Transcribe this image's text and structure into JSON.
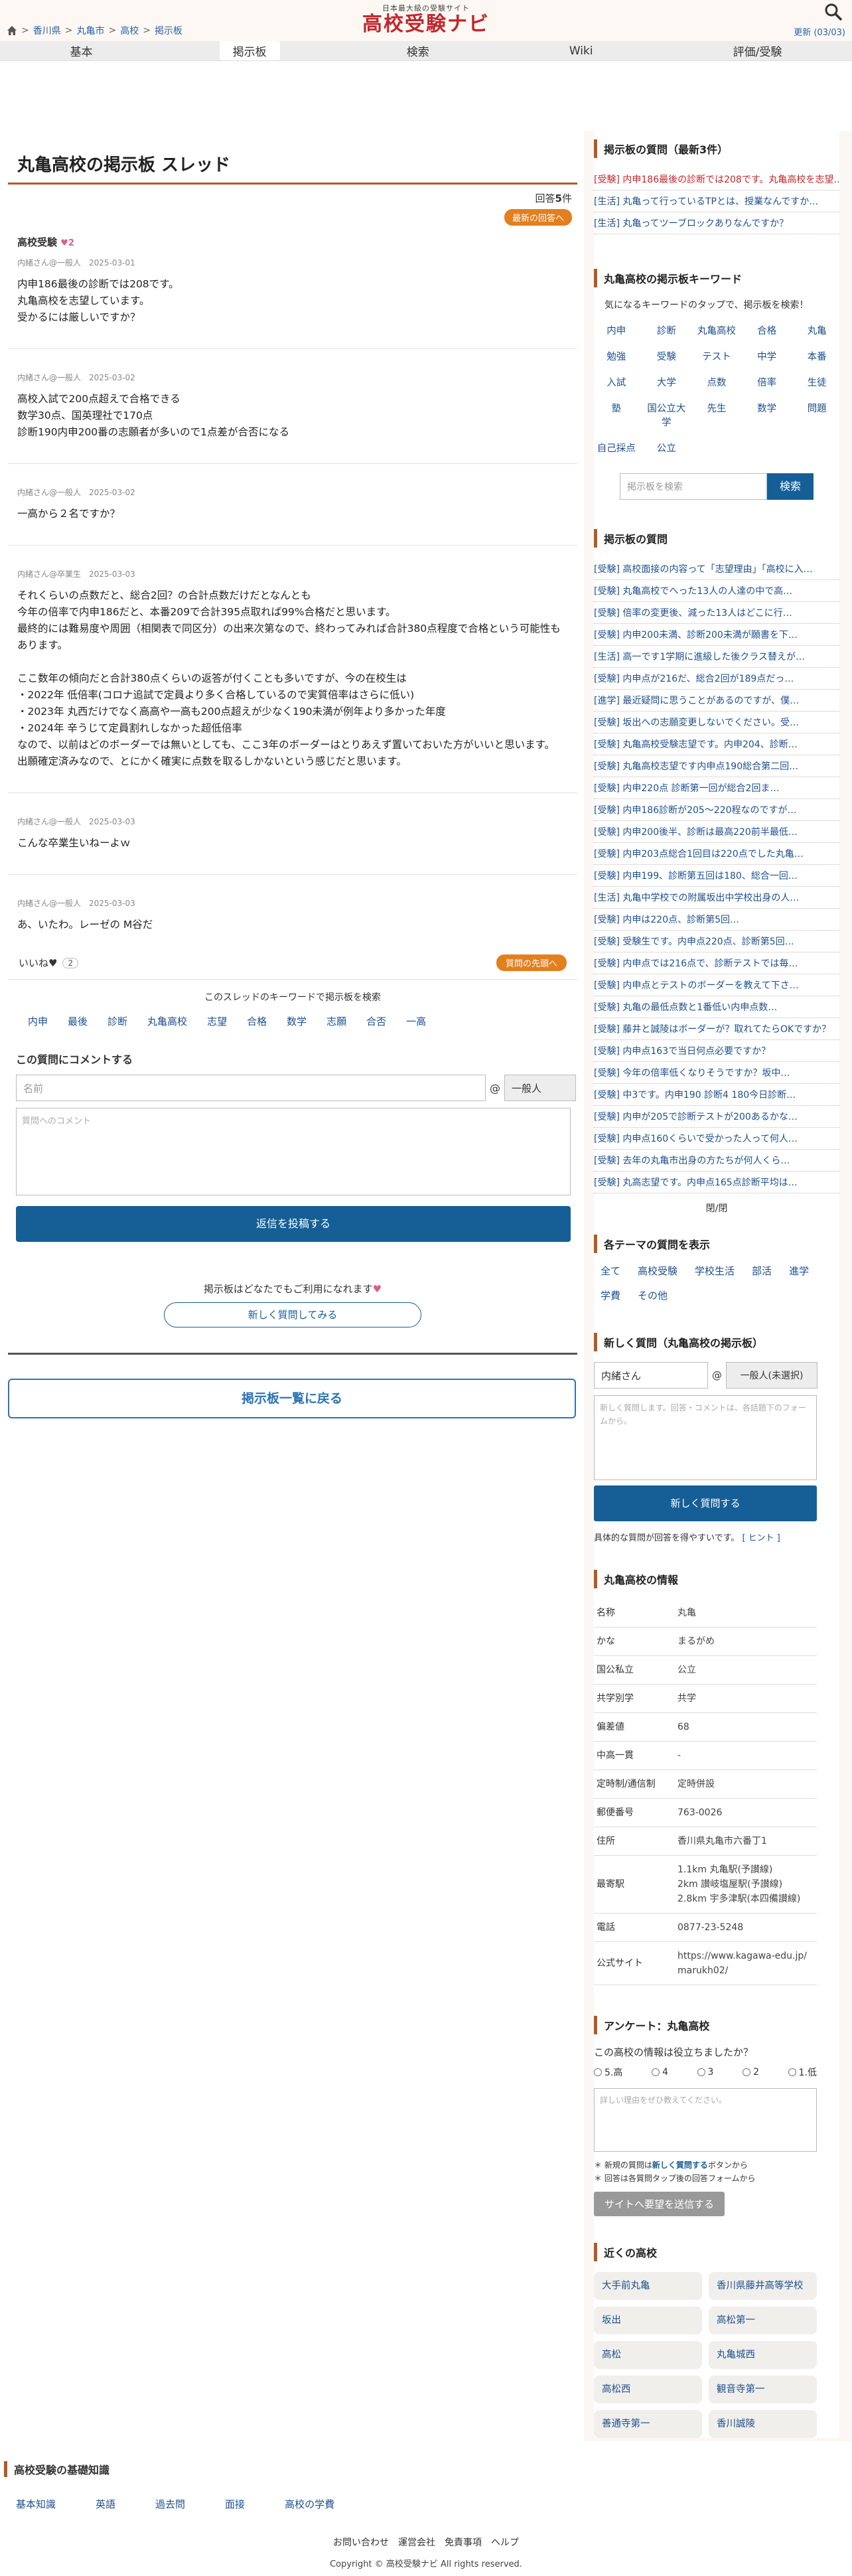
{
  "header": {
    "breadcrumb": [
      "香川県",
      "丸亀市",
      "高校",
      "掲示板"
    ],
    "logo_tag": "日本最大級の受験サイト",
    "logo_name": "高校受験ナビ",
    "updated": "更新 (03/03)"
  },
  "nav": [
    "基本",
    "掲示板",
    "検索",
    "Wiki",
    "評価/受験"
  ],
  "thread": {
    "title": "丸亀高校の掲示板 スレッド",
    "answers_label": "回答",
    "answers_count": "5",
    "answers_suffix": "件",
    "latest_btn": "最新の回答へ",
    "first_heading": "高校受験",
    "first_hearts": "♥2",
    "posts": [
      {
        "author": "内緒さん@一般人",
        "date": "2025-03-01",
        "body": "内申186最後の診断では208です。\n丸亀高校を志望しています。\n受かるには厳しいですか？"
      },
      {
        "author": "内緒さん@一般人",
        "date": "2025-03-02",
        "body": "高校入試で200点超えで合格できる\n数学30点、国英理社で170点\n診断190内申200番の志願者が多いので1点差が合否になる"
      },
      {
        "author": "内緒さん@一般人",
        "date": "2025-03-02",
        "body": "一高から２名ですか？"
      },
      {
        "author": "内緒さん@卒業生",
        "date": "2025-03-03",
        "body": "それくらいの点数だと、総合2回？の合計点数だけだとなんとも\n今年の倍率で内申186だと、本番209で合計395点取れば99%合格だと思います。\n最終的には難易度や周囲（相関表で同区分）の出来次第なので、終わってみれば合計380点程度で合格という可能性もあります。\n\nここ数年の傾向だと合計380点くらいの返答が付くことも多いですが、今の在校生は\n・2022年 低倍率(コロナ追試で定員より多く合格しているので実質倍率はさらに低い)\n・2023年 丸西だけでなく高高や一高も200点超えが少なく190未満が例年より多かった年度\n・2024年 辛うじて定員割れしなかった超低倍率\nなので、以前はどのボーダーでは無いとしても、ここ3年のボーダーはとりあえず置いておいた方がいいと思います。\n出願確定済みなので、とにかく確実に点数を取るしかないという感じだと思います。"
      },
      {
        "author": "内緒さん@一般人",
        "date": "2025-03-03",
        "body": "こんな卒業生いねーよｗ"
      },
      {
        "author": "内緒さん@一般人",
        "date": "2025-03-03",
        "body": "あ、いたわ。レーゼの M谷だ"
      }
    ],
    "like_label": "いいね♥",
    "like_count": "2",
    "first_btn": "質問の先頭へ",
    "kw_search_label": "このスレッドのキーワードで掲示板を検索",
    "keywords": [
      "内申",
      "最後",
      "診断",
      "丸亀高校",
      "志望",
      "合格",
      "数学",
      "志願",
      "合否",
      "一高"
    ]
  },
  "comment_form": {
    "title": "この質問にコメントする",
    "name_placeholder": "名前",
    "at": "@",
    "tag": "一般人",
    "comment_placeholder": "質問へのコメント",
    "submit": "返信を投稿する",
    "free_note": "掲示板はどなたでもご利用になれます",
    "new_q_btn": "新しく質問してみる",
    "back_btn": "掲示板一覧に戻る"
  },
  "sidebar": {
    "latest_title": "掲示板の質問（最新3件）",
    "latest_items": [
      "[受験] 内申186最後の診断では208です。丸亀高校を志望…",
      "[生活] 丸亀って行っているTPとは、授業なんですか…",
      "[生活] 丸亀ってツーブロックありなんですか？"
    ],
    "kw_title": "丸亀高校の掲示板キーワード",
    "kw_desc": "気になるキーワードのタップで、掲示板を検索！",
    "kw_items": [
      "内申",
      "診断",
      "丸亀高校",
      "合格",
      "丸亀",
      "勉強",
      "受験",
      "テスト",
      "中学",
      "本番",
      "入試",
      "大学",
      "点数",
      "倍率",
      "生徒",
      "塾",
      "国公立大学",
      "先生",
      "数学",
      "問題",
      "自己採点",
      "公立"
    ],
    "kw_search_placeholder": "掲示板を検索",
    "kw_search_btn": "検索",
    "questions_title": "掲示板の質問",
    "questions": [
      "[受験] 高校面接の内容って「志望理由」「高校に入…",
      "[受験] 丸亀高校でへった13人の人達の中で高…",
      "[受験] 倍率の変更後、減った13人はどこに行…",
      "[受験] 内申200未満、診断200未満が願書を下…",
      "[生活] 高一です1学期に進級した後クラス替えが…",
      "[受験] 内申点が216だ、総合2回が189点だっ…",
      "[進学] 最近疑問に思うことがあるのですが、僕…",
      "[受験] 坂出への志願変更しないでください。受…",
      "[受験] 丸亀高校受験志望です。内申204、診断…",
      "[受験] 丸亀高校志望です内申点190総合第二回…",
      "[受験] 内申220点 診断第一回が総合2回ま…",
      "[受験] 内申186診断が205〜220程なのですが…",
      "[受験] 内申200後半、診断は最高220前半最低…",
      "[受験] 内申203点総合1回目は220点でした丸亀…",
      "[受験] 内申199、診断第五回は180、総合一回…",
      "[生活] 丸亀中学校での附属坂出中学校出身の人…",
      "[受験] 内申は220点、診断第5回…",
      "[受験] 受験生です。内申点220点、診断第5回…",
      "[受験] 内申点では216点で、診断テストでは毎…",
      "[受験] 内申点とテストのボーダーを教えて下さ…",
      "[受験] 丸亀の最低点数と1番低い内申点数…",
      "[受験] 藤井と誠陵はボーダーが？取れてたらOKですか？",
      "[受験] 内申点163で当日何点必要ですか？",
      "[受験] 今年の倍率低くなりそうですか？坂中…",
      "[受験] 中3です。内申190 診断4 180今日診断…",
      "[受験] 内申が205で診断テストが200あるかな…",
      "[受験] 内申点160くらいで受かった人って何人…",
      "[受験] 去年の丸亀市出身の方たちが何人くら…",
      "[受験] 丸高志望です。内申点165点診断平均は…"
    ],
    "pager": "閉/閉",
    "themes_title": "各テーマの質問を表示",
    "themes": [
      "全て",
      "高校受験",
      "学校生活",
      "部活",
      "進学",
      "学費",
      "その他"
    ],
    "newq_title": "新しく質問（丸亀高校の掲示板）",
    "newq_name": "内緒さん",
    "newq_at": "@",
    "newq_tag": "一般人(未選択)",
    "newq_placeholder": "新しく質問します。回答・コメントは、各話題下のフォームから。",
    "newq_submit": "新しく質問する",
    "newq_note": "具体的な質問が回答を得やすいです。",
    "newq_hint": "[ ヒント ]",
    "info_title": "丸亀高校の情報",
    "info": [
      {
        "k": "名称",
        "v": "丸亀"
      },
      {
        "k": "かな",
        "v": "まるがめ"
      },
      {
        "k": "国公私立",
        "v": "公立"
      },
      {
        "k": "共学別学",
        "v": "共学"
      },
      {
        "k": "偏差値",
        "v": "68"
      },
      {
        "k": "中高一貫",
        "v": "-"
      },
      {
        "k": "定時制/通信制",
        "v": "定時併設"
      },
      {
        "k": "郵便番号",
        "v": "763-0026"
      },
      {
        "k": "住所",
        "v": "香川県丸亀市六番丁1"
      },
      {
        "k": "最寄駅",
        "v": "1.1km 丸亀駅(予讃線)\n2km 讃岐塩屋駅(予讃線)\n2.8km 宇多津駅(本四備讃線)"
      },
      {
        "k": "電話",
        "v": "0877-23-5248"
      },
      {
        "k": "公式サイト",
        "v": "https://www.kagawa-edu.jp/marukh02/"
      }
    ],
    "survey_title": "アンケート：丸亀高校",
    "survey_q": "この高校の情報は役立ちましたか？",
    "survey_options": [
      "5.高",
      "4",
      "3",
      "2",
      "1.低"
    ],
    "survey_placeholder": "詳しい理由をぜひ教えてください。",
    "survey_note1_pre": "新規の質問は",
    "survey_note1_link": "新しく質問する",
    "survey_note1_post": "ボタンから",
    "survey_note2": "回答は各質問タップ後の回答フォームから",
    "survey_btn": "サイトへ要望を送信する",
    "near_title": "近くの高校",
    "near": [
      "大手前丸亀",
      "香川県藤井高等学校",
      "坂出",
      "高松第一",
      "高松",
      "丸亀城西",
      "高松西",
      "観音寺第一",
      "善通寺第一",
      "香川誠陵"
    ]
  },
  "footer": {
    "basics_title": "高校受験の基礎知識",
    "basics_links": [
      "基本知識",
      "英語",
      "過去問",
      "面接",
      "高校の学費"
    ],
    "links": [
      "お問い合わせ",
      "運営会社",
      "免責事項",
      "ヘルプ"
    ],
    "copyright": "Copyright © 高校受験ナビ All rights reserved."
  }
}
